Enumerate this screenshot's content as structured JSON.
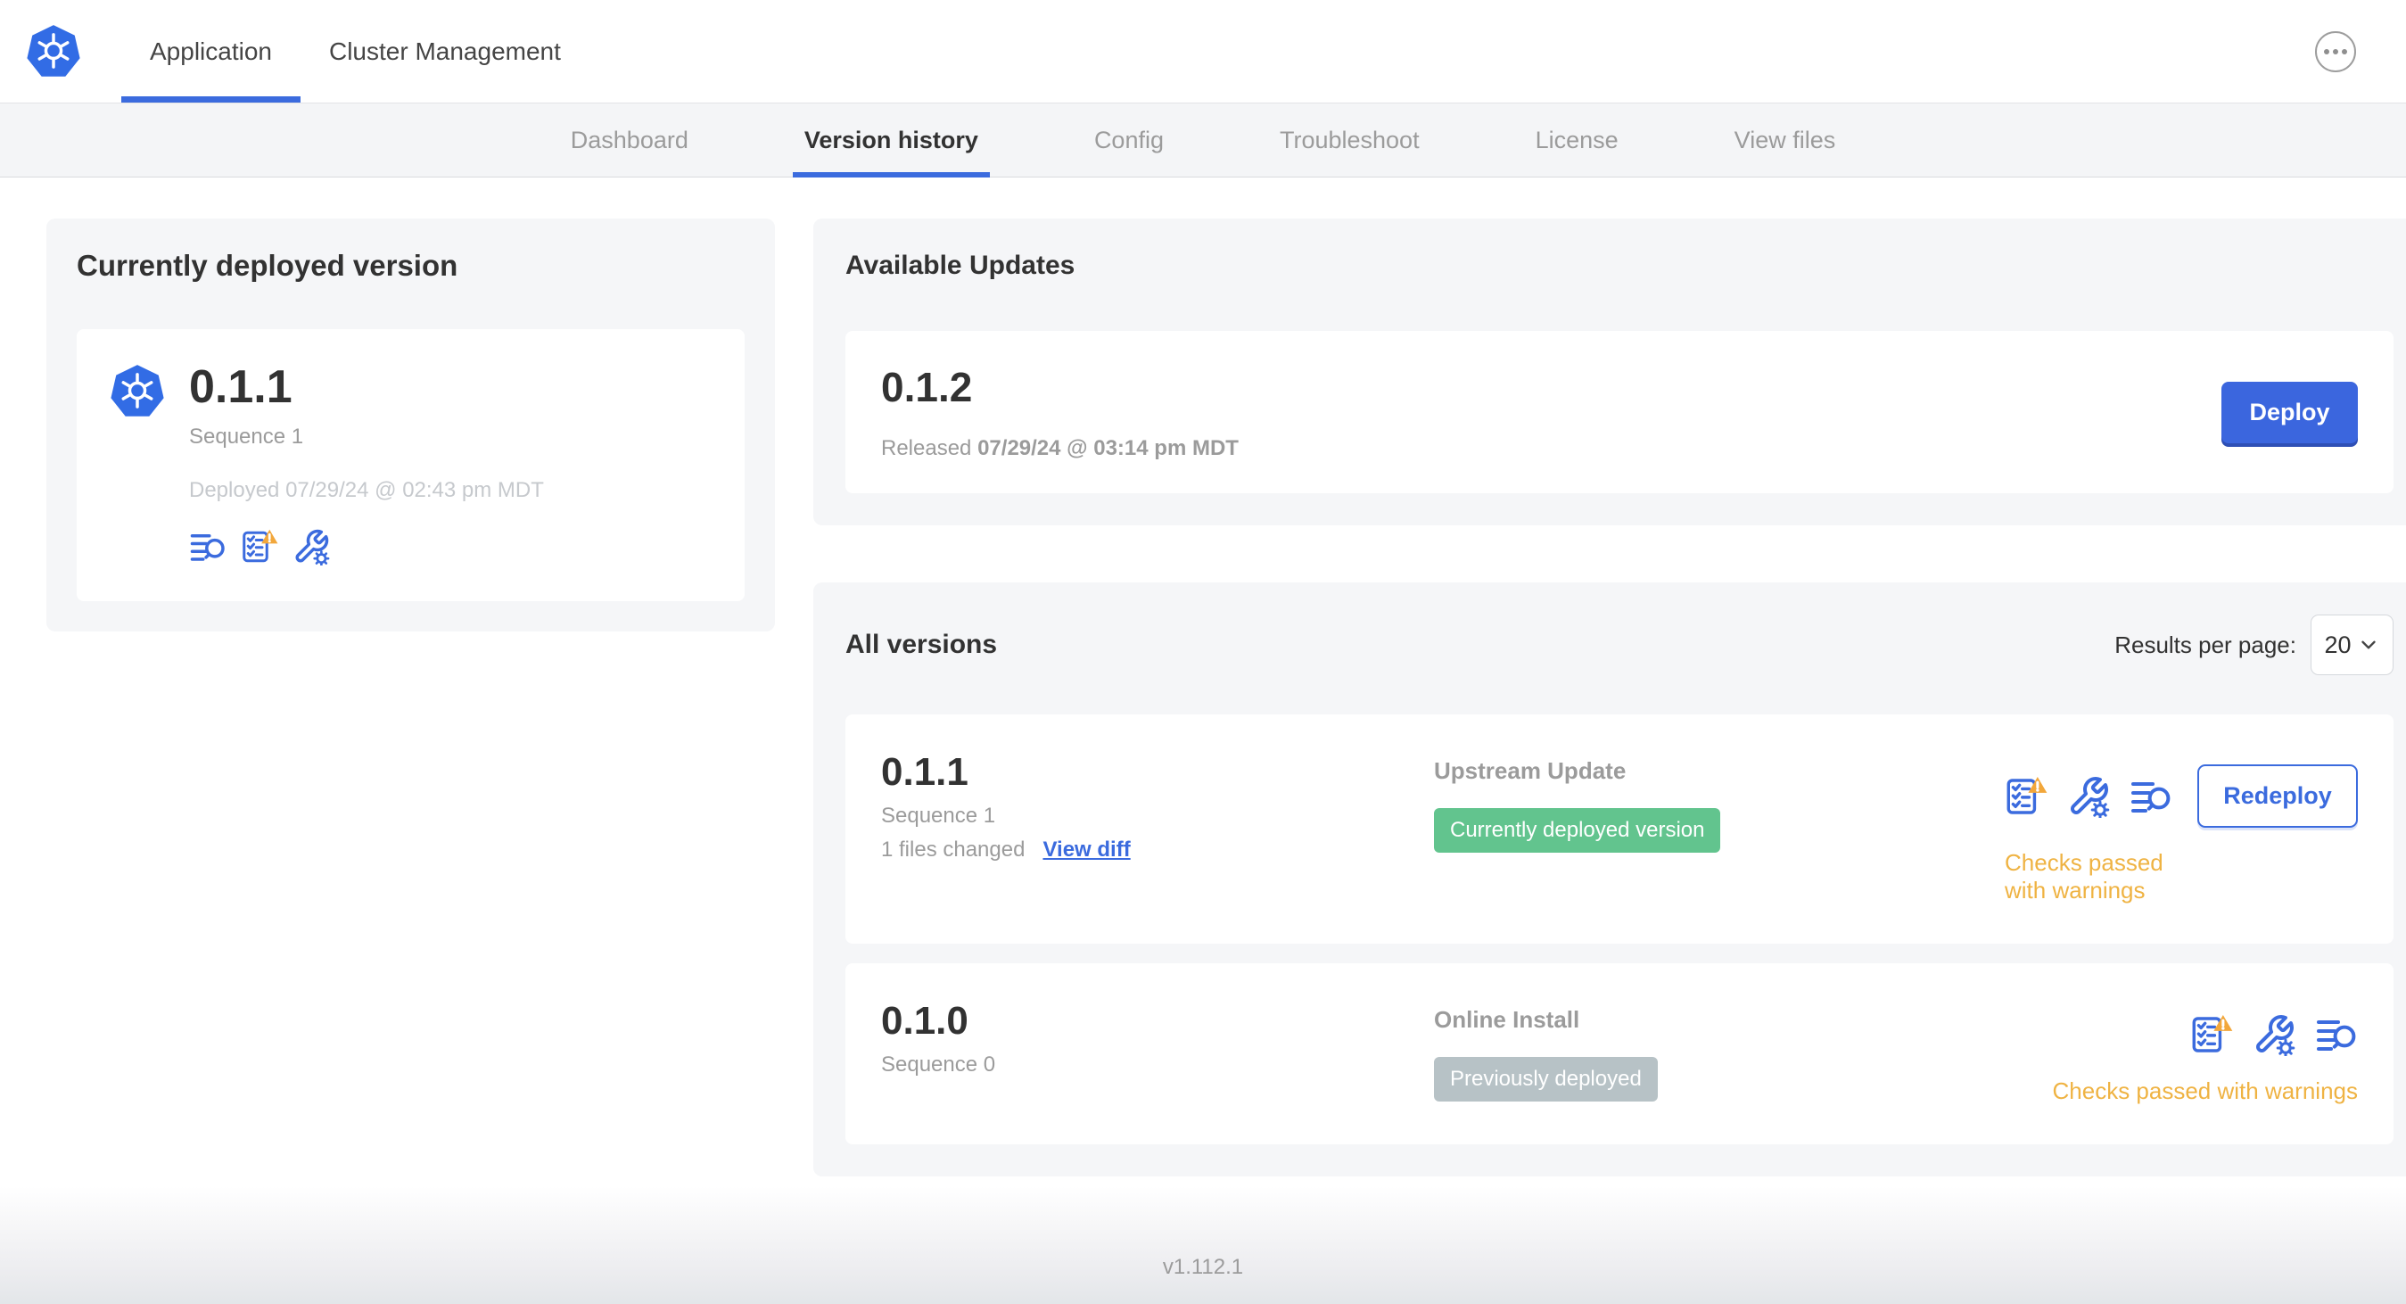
{
  "header": {
    "app_tab": "Application",
    "cluster_tab": "Cluster Management"
  },
  "subnav": {
    "tabs": [
      {
        "label": "Dashboard",
        "active": false
      },
      {
        "label": "Version history",
        "active": true
      },
      {
        "label": "Config",
        "active": false
      },
      {
        "label": "Troubleshoot",
        "active": false
      },
      {
        "label": "License",
        "active": false
      },
      {
        "label": "View files",
        "active": false
      }
    ]
  },
  "current_version": {
    "title": "Currently deployed version",
    "version": "0.1.1",
    "sequence": "Sequence 1",
    "deployed": "Deployed 07/29/24 @ 02:43 pm MDT"
  },
  "available_updates": {
    "title": "Available Updates",
    "version": "0.1.2",
    "released_prefix": "Released",
    "released_date": "07/29/24 @ 03:14 pm MDT",
    "deploy_label": "Deploy"
  },
  "all_versions": {
    "title": "All versions",
    "results_per_page_label": "Results per page:",
    "results_per_page_value": "20",
    "rows": [
      {
        "version": "0.1.1",
        "sequence": "Sequence 1",
        "files_changed": "1 files changed",
        "view_diff_label": "View diff",
        "source": "Upstream Update",
        "badge": "Currently deployed version",
        "action_label": "Redeploy",
        "status": "Checks passed with warnings"
      },
      {
        "version": "0.1.0",
        "sequence": "Sequence 0",
        "source": "Online Install",
        "badge": "Previously deployed",
        "status": "Checks passed with warnings"
      }
    ]
  },
  "footer": {
    "version": "v1.112.1"
  },
  "icons": {
    "brand": "kubernetes-logo",
    "more": "ellipsis-more-icon",
    "logs": "logs-search-icon",
    "preflight": "preflight-checklist-icon",
    "preflight_warning": "warning-triangle-icon",
    "config": "wrench-gear-icon",
    "select_chevron": "chevron-down-icon"
  },
  "colors": {
    "accent_blue": "#3B6BDE",
    "kubernetes_blue": "#326CE5",
    "deploy_button": "#3B66DE",
    "green_badge": "#62C48E",
    "gray_badge": "#B7C2C6",
    "warning_amber": "#F2A73B",
    "warning_text": "#EFB343",
    "panel_gray": "#F5F6F8",
    "text_dark": "#323232",
    "text_gray": "#9B9B9B",
    "text_light_gray": "#C6C9CD"
  }
}
